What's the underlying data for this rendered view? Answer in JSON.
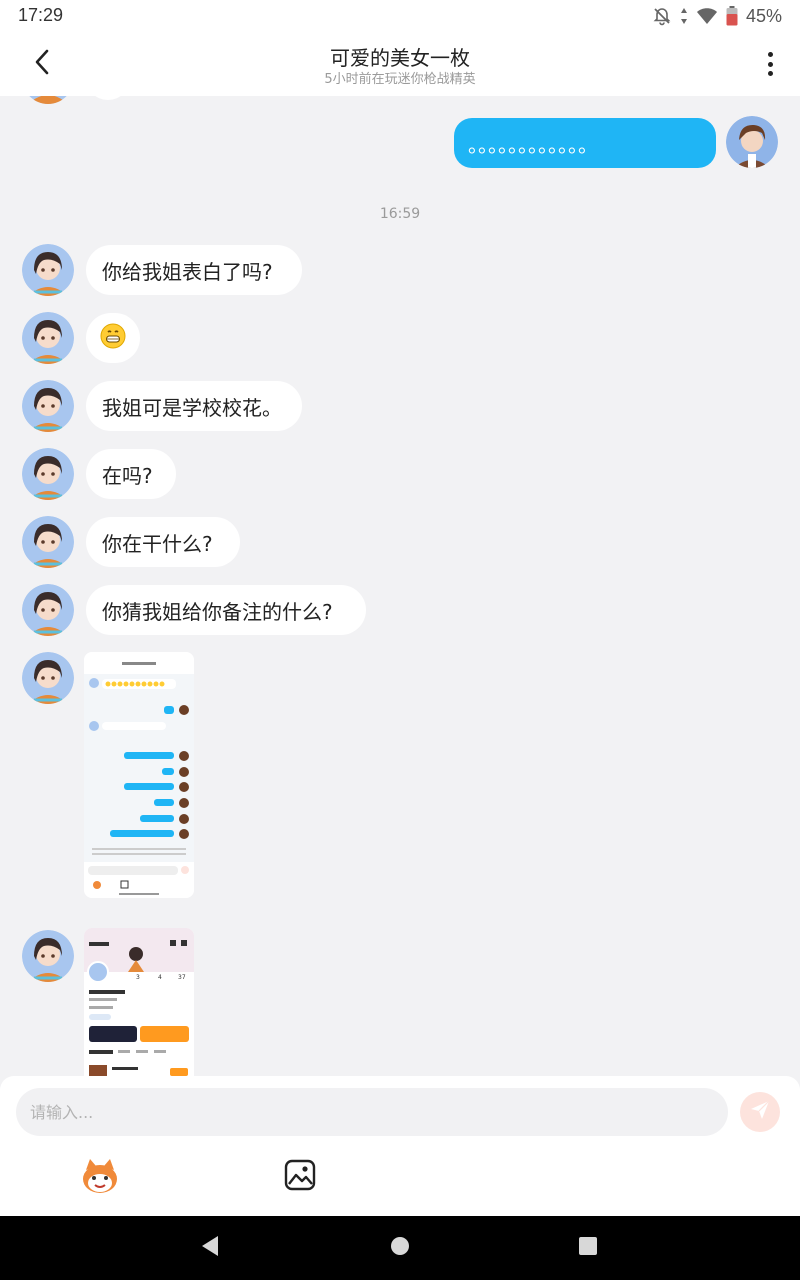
{
  "status_bar": {
    "time": "17:29",
    "battery": "45%"
  },
  "header": {
    "title": "可爱的美女一枚",
    "subtitle": "5小时前在玩迷你枪战精英"
  },
  "chat": {
    "self_message": "。。。。。。。。。。。。",
    "time_separator": "16:59",
    "incoming_messages": [
      "你给我姐表白了吗?",
      "😁",
      "我姐可是学校校花。",
      "在吗?",
      "你在干什么?",
      "你猜我姐给你备注的什么?"
    ]
  },
  "input": {
    "placeholder": "请输入..."
  },
  "colors": {
    "accent_blue": "#1fb5f5",
    "send_button": "#fde3dd",
    "background": "#f2f2f4"
  }
}
